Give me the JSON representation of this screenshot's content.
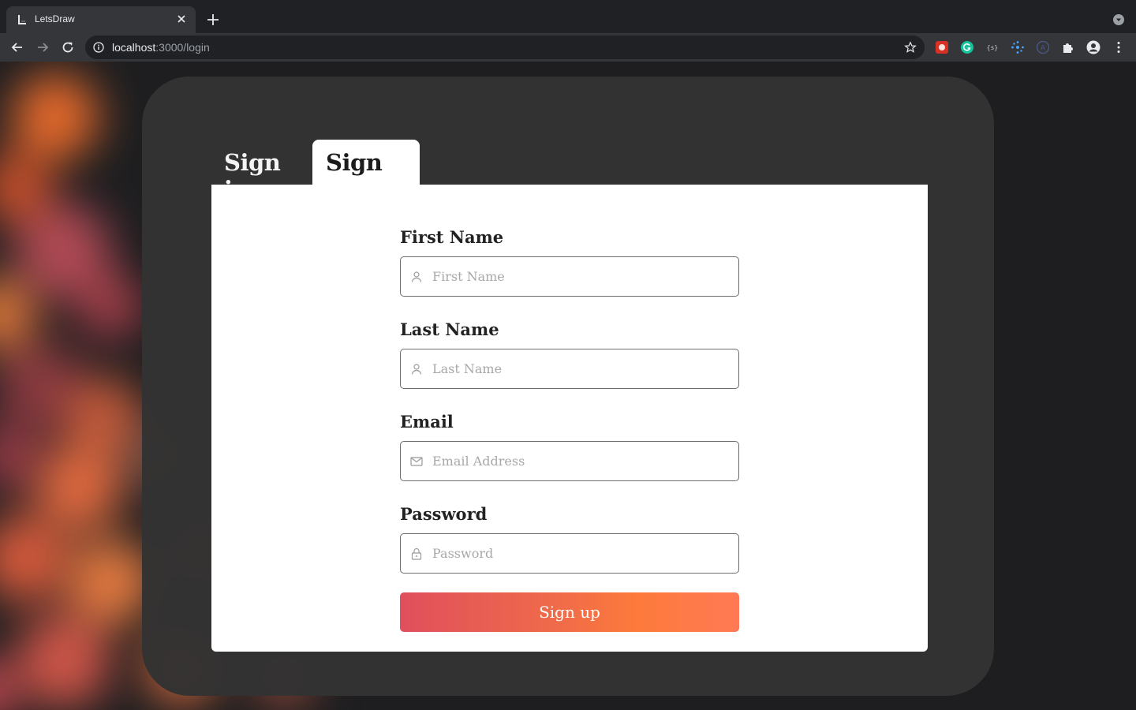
{
  "browser": {
    "tab_title": "LetsDraw",
    "url_host": "localhost",
    "url_path": ":3000/login"
  },
  "auth": {
    "tabs": [
      {
        "label": "Sign in",
        "active": false
      },
      {
        "label": "Sign up",
        "active": true
      }
    ],
    "fields": [
      {
        "label": "First Name",
        "placeholder": "First Name",
        "icon": "user-icon"
      },
      {
        "label": "Last Name",
        "placeholder": "Last Name",
        "icon": "user-icon"
      },
      {
        "label": "Email",
        "placeholder": "Email Address",
        "icon": "mail-icon"
      },
      {
        "label": "Password",
        "placeholder": "Password",
        "icon": "lock-icon"
      }
    ],
    "submit_label": "Sign up"
  },
  "colors": {
    "page_background": "#1e1e20",
    "card_background": "#333333",
    "button_gradient_start": "#e04f5c",
    "button_gradient_end": "#ff7a55"
  }
}
